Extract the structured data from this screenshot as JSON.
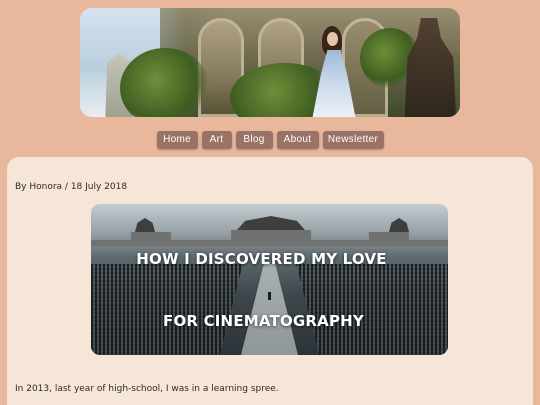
{
  "nav": {
    "items": [
      {
        "label": "Home"
      },
      {
        "label": "Art"
      },
      {
        "label": "Blog"
      },
      {
        "label": "About"
      },
      {
        "label": "Newsletter"
      }
    ]
  },
  "post": {
    "byline": "By Honora / 18 July 2018",
    "hero": {
      "title_line1": "HOW I DISCOVERED MY LOVE",
      "title_line2": "FOR CINEMATOGRAPHY"
    },
    "first_paragraph": "In 2013, last year of high-school, I was in a learning spree."
  },
  "colors": {
    "page_background": "#e9b89c",
    "card_background": "#f6e6d8",
    "nav_button": "#9a7266",
    "nav_text": "#ffffff"
  }
}
